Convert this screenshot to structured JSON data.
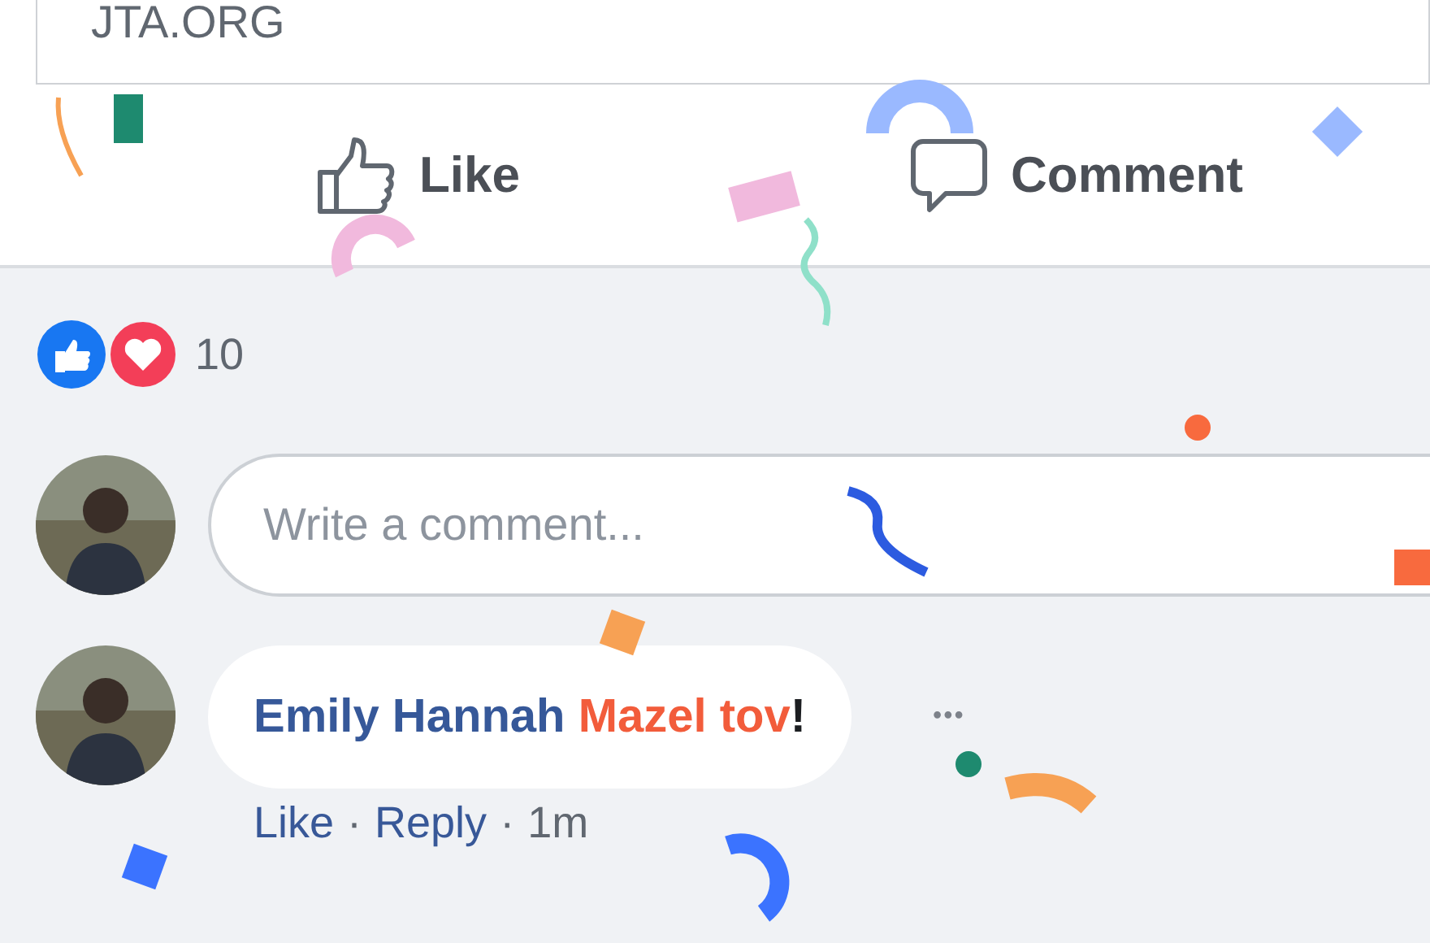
{
  "link_card": {
    "domain": "JTA.ORG"
  },
  "actions": [
    {
      "label": "Like",
      "kind": "like"
    },
    {
      "label": "Comment",
      "kind": "comment"
    }
  ],
  "reactions": {
    "count": "10"
  },
  "composer": {
    "placeholder": "Write a comment..."
  },
  "comments": [
    {
      "author": "Emily Hannah",
      "parts": [
        {
          "text": "Mazel tov",
          "kind": "highlight"
        },
        {
          "text": "!",
          "kind": "plain"
        }
      ],
      "more": "•••",
      "links": [
        "Like",
        "Reply"
      ],
      "separator": "·",
      "time": "1m"
    }
  ]
}
